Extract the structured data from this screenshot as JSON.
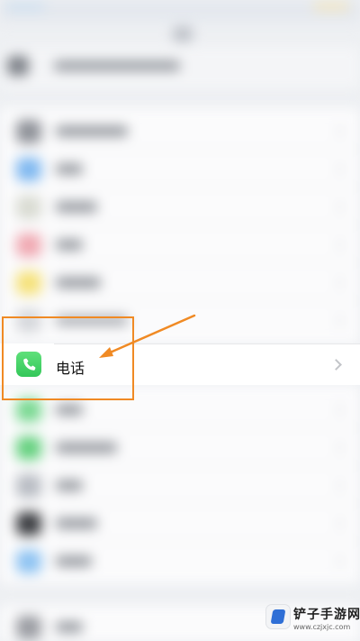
{
  "settings_list": {
    "highlighted_item": {
      "label": "电话",
      "icon": "phone-icon",
      "icon_color": "#34c759"
    }
  },
  "annotation": {
    "color": "#f08a24"
  },
  "watermark": {
    "title": "铲子手游网",
    "url": "www.czjxjc.com"
  }
}
